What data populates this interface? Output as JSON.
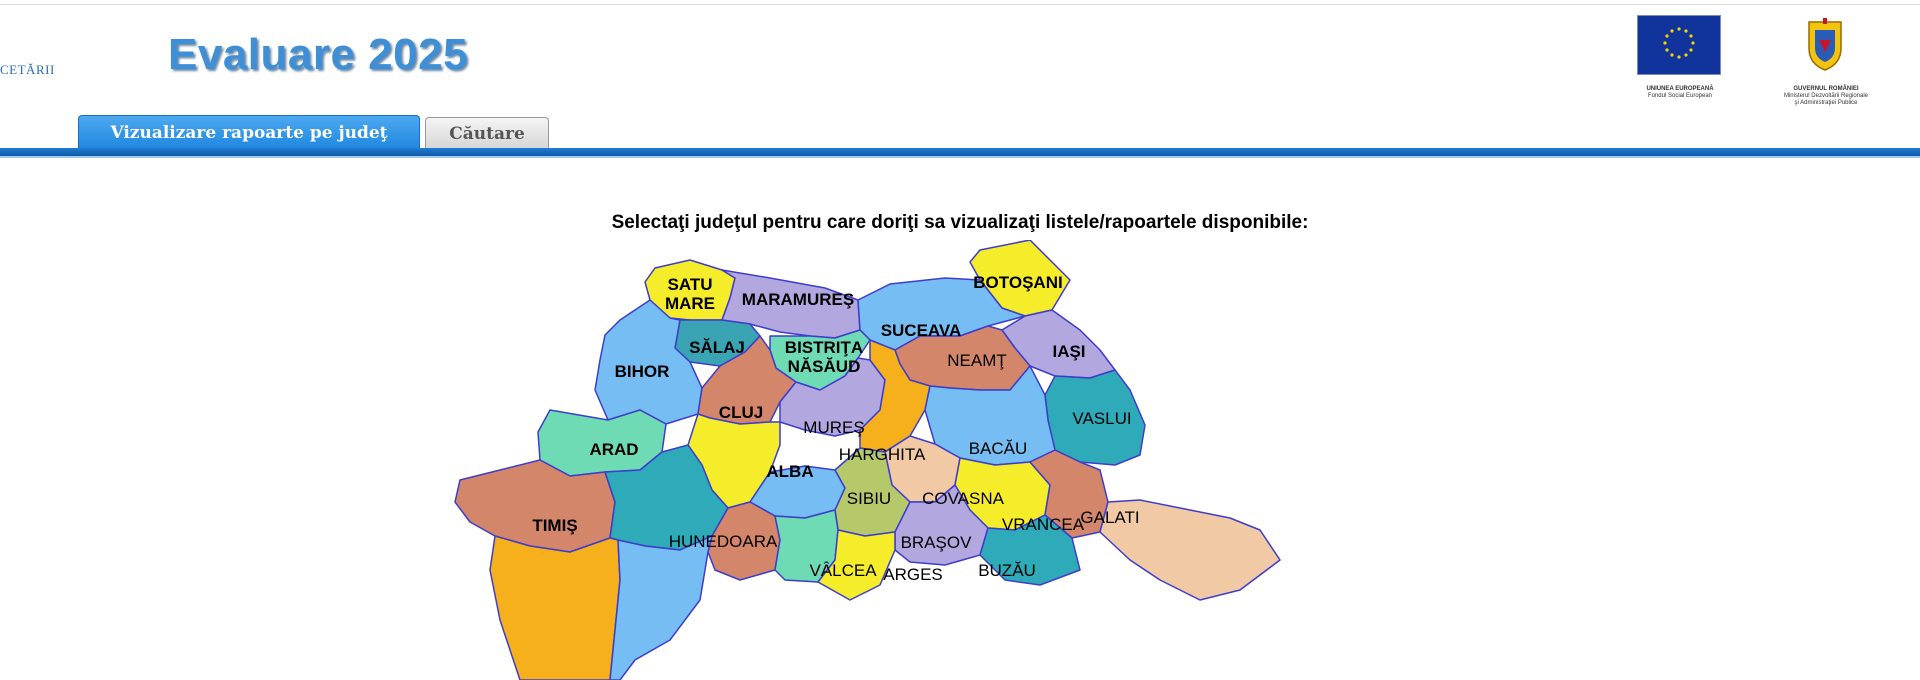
{
  "header": {
    "left_text": "CETĂRII",
    "title": "Evaluare 2025",
    "logos": [
      {
        "name": "eu-flag-logo",
        "caption_1": "UNIUNEA EUROPEANĂ",
        "caption_2": "Fondul Social European"
      },
      {
        "name": "romania-coat-of-arms-logo",
        "caption_1": "GUVERNUL ROMÂNIEI",
        "caption_2": "Ministerul Dezvoltării Regionale",
        "caption_3": "şi Administraţiei Publice"
      }
    ]
  },
  "tabs": [
    {
      "label": "Vizualizare rapoarte pe judeţ",
      "active": true
    },
    {
      "label": "Căutare",
      "active": false
    }
  ],
  "main": {
    "instruction": "Selectaţi judeţul pentru care doriţi sa vizualizaţi listele/rapoartele disponibile:"
  },
  "colors": {
    "accent": "#1f87e0",
    "title": "#3f8fd6",
    "border": "#3d3dcc"
  },
  "counties": [
    {
      "id": "satu-mare",
      "line1": "SATU",
      "line2": "MARE",
      "color": "#f5ec2a"
    },
    {
      "id": "maramures",
      "line1": "MARAMUREŞ",
      "color": "#b3a7e0"
    },
    {
      "id": "botosani",
      "line1": "BOTOŞANI",
      "color": "#f5ec2a"
    },
    {
      "id": "suceava",
      "line1": "SUCEAVA",
      "color": "#75bdf2"
    },
    {
      "id": "bistrita-nasaud",
      "line1": "BISTRIŢA",
      "line2": "NĂSĂUD",
      "color": "#6fdbb5"
    },
    {
      "id": "salaj",
      "line1": "SĂLAJ",
      "color": "#3aa4b4"
    },
    {
      "id": "bihor",
      "line1": "BIHOR",
      "color": "#75bdf2"
    },
    {
      "id": "iasi",
      "line1": "IAŞI",
      "color": "#b3a7e0"
    },
    {
      "id": "cluj",
      "line1": "CLUJ",
      "color": "#d3866a"
    },
    {
      "id": "neamt",
      "line1": "NEAMŢ",
      "color": "#d3866a"
    },
    {
      "id": "mures",
      "line1": "MUREŞ",
      "color": "#b3a7e0"
    },
    {
      "id": "harghita",
      "line1": "HARGHITA",
      "color": "#f5b01c"
    },
    {
      "id": "vaslui",
      "line1": "VASLUI",
      "color": "#2eaab8"
    },
    {
      "id": "bacau",
      "line1": "BACĂU",
      "color": "#75bdf2"
    },
    {
      "id": "arad",
      "line1": "ARAD",
      "color": "#6fdbb5"
    },
    {
      "id": "alba",
      "line1": "ALBA",
      "color": "#f5ec2a"
    },
    {
      "id": "sibiu",
      "line1": "SIBIU",
      "color": "#75bdf2"
    },
    {
      "id": "covasna",
      "line1": "COVASNA",
      "color": "#f2c9a5"
    },
    {
      "id": "timis",
      "line1": "TIMIŞ",
      "color": "#d3866a"
    },
    {
      "id": "hunedoara",
      "line1": "HUNEDOARA",
      "color": "#2eaab8"
    },
    {
      "id": "brasov",
      "line1": "BRAŞOV",
      "color": "#b5c86a"
    },
    {
      "id": "vrancea",
      "line1": "VRANCEA",
      "color": "#f5ec2a"
    },
    {
      "id": "galati",
      "line1": "GALATI",
      "color": "#d3866a"
    },
    {
      "id": "valcea",
      "line1": "VÂLCEA",
      "color": "#d3866a"
    },
    {
      "id": "arges",
      "line1": "ARGES",
      "color": "#6fdbb5"
    },
    {
      "id": "buzau",
      "line1": "BUZĂU",
      "color": "#b3a7e0"
    }
  ]
}
